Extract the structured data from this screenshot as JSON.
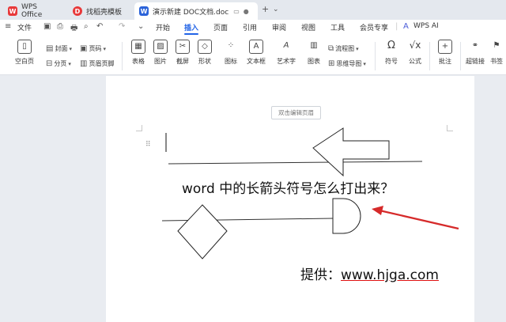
{
  "tabs": [
    {
      "label": "WPS Office",
      "icon": "wps-icon"
    },
    {
      "label": "找稻壳模板",
      "icon": "docer-icon"
    },
    {
      "label": "演示新建 DOC文档.doc",
      "icon": "word-doc-icon"
    }
  ],
  "menu": {
    "file": "文件",
    "items": [
      "开始",
      "插入",
      "页面",
      "引用",
      "审阅",
      "视图",
      "工具",
      "会员专享"
    ],
    "active": "插入",
    "wps_ai": "WPS AI"
  },
  "ribbon": {
    "blank_page": "空白页",
    "cover": "封面",
    "section": "分页",
    "page_number": "页码",
    "header_footer": "页眉页脚",
    "table": "表格",
    "picture": "图片",
    "screenshot": "截屏",
    "shape": "形状",
    "icon": "图标",
    "textbox": "文本框",
    "wordart": "艺术字",
    "chart": "图表",
    "flowchart": "流程图",
    "mindmap": "思维导图",
    "symbol": "符号",
    "formula": "公式",
    "comment": "批注",
    "hyperlink": "超链接",
    "bookmark": "书签"
  },
  "document": {
    "header_hint": "双击编辑页眉",
    "title": "word 中的长箭头符号怎么打出来？",
    "source_label": "提供：",
    "source_url": "www.hjga.com"
  },
  "colors": {
    "accent": "#2163e6",
    "arrow_red": "#d62a2a",
    "wps_red": "#e8393a"
  }
}
